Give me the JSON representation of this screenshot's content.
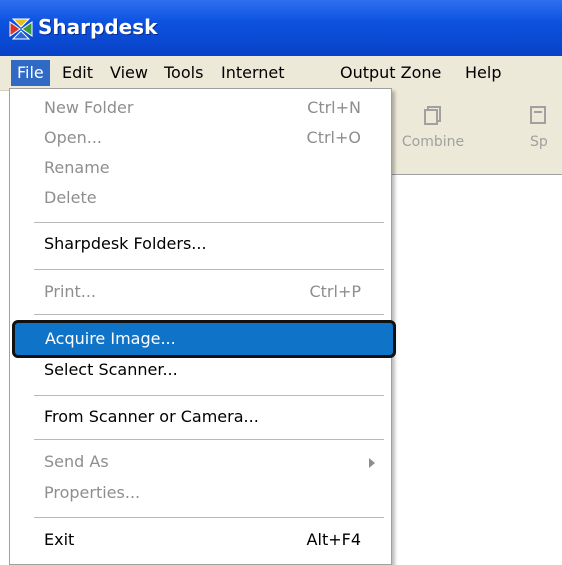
{
  "window": {
    "title": "Sharpdesk",
    "icon": "sharpdesk-logo-icon"
  },
  "menubar": {
    "items": [
      "File",
      "Edit",
      "View",
      "Tools",
      "Internet",
      "Output Zone",
      "Help"
    ]
  },
  "toolbar": {
    "buttons": [
      {
        "label": "Combine",
        "icon": "combine-icon"
      },
      {
        "label": "Sp",
        "icon": "split-icon"
      }
    ]
  },
  "file_menu": {
    "new_folder": {
      "label": "New Folder",
      "shortcut": "Ctrl+N"
    },
    "open": {
      "label": "Open...",
      "shortcut": "Ctrl+O"
    },
    "rename": {
      "label": "Rename"
    },
    "delete": {
      "label": "Delete"
    },
    "sharpdesk_folders": {
      "label": "Sharpdesk Folders..."
    },
    "print": {
      "label": "Print...",
      "shortcut": "Ctrl+P"
    },
    "acquire_image": {
      "label": "Acquire Image..."
    },
    "select_scanner": {
      "label": "Select Scanner..."
    },
    "from_scanner": {
      "label": "From Scanner or Camera..."
    },
    "send_as": {
      "label": "Send As"
    },
    "properties": {
      "label": "Properties..."
    },
    "exit": {
      "label": "Exit",
      "shortcut": "Alt+F4"
    }
  },
  "colors": {
    "titlebar": "#0c52e0",
    "menu_highlight": "#0f74c8",
    "disabled_text": "#8e8e8e"
  }
}
